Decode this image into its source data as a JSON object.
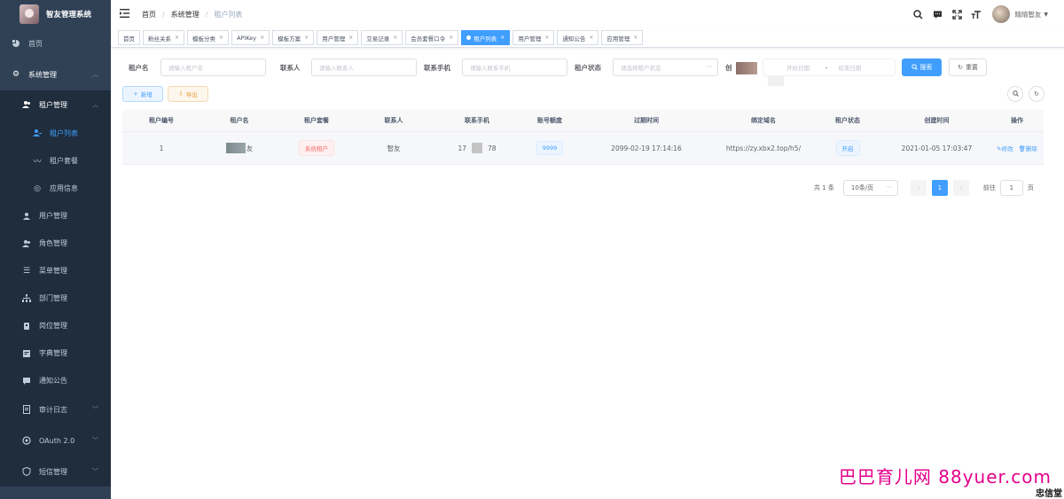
{
  "app": {
    "title": "智友管理系统"
  },
  "sidebar": {
    "items": [
      {
        "label": "首页",
        "icon": "dashboard-icon"
      },
      {
        "label": "系统管理",
        "icon": "gear-icon"
      },
      {
        "label": "租户管理",
        "icon": "user-group-icon"
      },
      {
        "label": "租户列表",
        "icon": "user-icon"
      },
      {
        "label": "租户套餐",
        "icon": "wave-icon"
      },
      {
        "label": "应用信息",
        "icon": "circle-icon"
      },
      {
        "label": "用户管理",
        "icon": "user-icon"
      },
      {
        "label": "角色管理",
        "icon": "user-group-icon"
      },
      {
        "label": "菜单管理",
        "icon": "list-icon"
      },
      {
        "label": "部门管理",
        "icon": "tree-icon"
      },
      {
        "label": "岗位管理",
        "icon": "post-icon"
      },
      {
        "label": "字典管理",
        "icon": "dict-icon"
      },
      {
        "label": "通知公告",
        "icon": "message-icon"
      },
      {
        "label": "审计日志",
        "icon": "log-icon"
      },
      {
        "label": "OAuth 2.0",
        "icon": "oauth-icon"
      },
      {
        "label": "短信管理",
        "icon": "sms-icon"
      }
    ]
  },
  "navbar": {
    "breadcrumb": [
      "首页",
      "系统管理",
      "租户列表"
    ],
    "username": "晴晴智友"
  },
  "tags": [
    {
      "label": "首页"
    },
    {
      "label": "粉丝关系"
    },
    {
      "label": "模板分类"
    },
    {
      "label": "APIKey"
    },
    {
      "label": "模板方案"
    },
    {
      "label": "用户管理"
    },
    {
      "label": "交易记录"
    },
    {
      "label": "会员套餐口令"
    },
    {
      "label": "租户列表"
    },
    {
      "label": "用户管理"
    },
    {
      "label": "通知公告"
    },
    {
      "label": "应用管理"
    }
  ],
  "search": {
    "tenant_name_label": "租户名",
    "tenant_name_placeholder": "请输入租户名",
    "contact_label": "联系人",
    "contact_placeholder": "请输入联系人",
    "phone_label": "联系手机",
    "phone_placeholder": "请输入联系手机",
    "status_label": "租户状态",
    "status_placeholder": "请选择租户状态",
    "create_label": "创",
    "start_date_placeholder": "开始日期",
    "date_separator": "-",
    "end_date_placeholder": "结束日期",
    "search_button": "搜索",
    "reset_button": "重置"
  },
  "toolbar": {
    "add_button": "新增",
    "export_button": "导出"
  },
  "table": {
    "headers": [
      "租户编号",
      "租户名",
      "租户套餐",
      "联系人",
      "联系手机",
      "账号额度",
      "过期时间",
      "绑定域名",
      "租户状态",
      "创建时间",
      "操作"
    ],
    "rows": [
      {
        "id": "1",
        "name": "友",
        "package": "系统租户",
        "contact": "智友",
        "phone_prefix": "17",
        "phone_suffix": "78",
        "quota": "9999",
        "expire_time": "2099-02-19 17:14:16",
        "domain": "https://zy.xbx2.top/h5/",
        "status": "开启",
        "create_time": "2021-01-05 17:03:47",
        "edit": "修改",
        "delete": "删除"
      }
    ]
  },
  "pagination": {
    "total": "共 1 条",
    "page_size": "10条/页",
    "current_page": "1",
    "goto_label": "前往",
    "goto_value": "1",
    "page_unit": "页"
  },
  "watermark": {
    "text": "巴巴育儿网 88yuer.com",
    "corner_text": "忠信堂"
  },
  "colors": {
    "sidebar_bg": "#304156",
    "primary": "#409eff",
    "danger": "#f56c6c",
    "warning": "#e6a23c",
    "watermark": "#e4008c"
  }
}
